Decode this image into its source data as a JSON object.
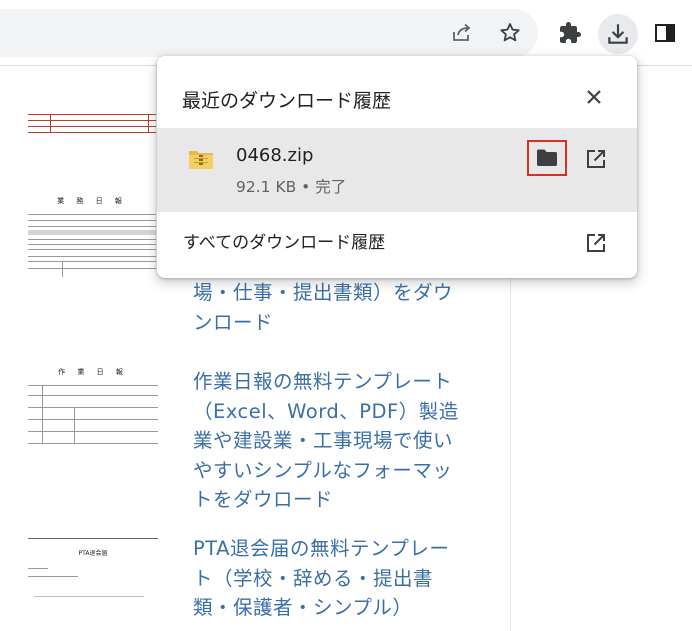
{
  "toolbar": {
    "icons": [
      "share-icon",
      "bookmark-star-icon",
      "extensions-puzzle-icon",
      "downloads-icon",
      "side-panel-icon"
    ]
  },
  "download_bubble": {
    "title": "最近のダウンロード履歴",
    "close_icon": "close-icon",
    "item": {
      "file_name": "0468.zip",
      "status": "92.1 KB • 完了",
      "file_icon": "zip-file-icon",
      "folder_icon": "folder-icon",
      "open_icon": "open-in-new-icon"
    },
    "all_history_label": "すべてのダウンロード履歴",
    "all_history_icon": "open-in-new-icon"
  },
  "articles": [
    {
      "title": "場・仕事・提出書類）をダウンロード",
      "thumbnail_title": "業 務 日 報"
    },
    {
      "title": "作業日報の無料テンプレート（Excel、Word、PDF）製造業や建設業・工事現場で使いやすいシンプルなフォーマットをダウロード",
      "thumbnail_title": "作 業 日 報"
    },
    {
      "title": "PTA退会届の無料テンプレート（学校・辞める・提出書類・保護者・シンプル）",
      "thumbnail_title": "PTA退会届"
    }
  ],
  "colors": {
    "link": "#3b6fa8",
    "highlight_border": "#d93025",
    "row_background": "#e8e8e8",
    "icon": "#5f6368"
  }
}
